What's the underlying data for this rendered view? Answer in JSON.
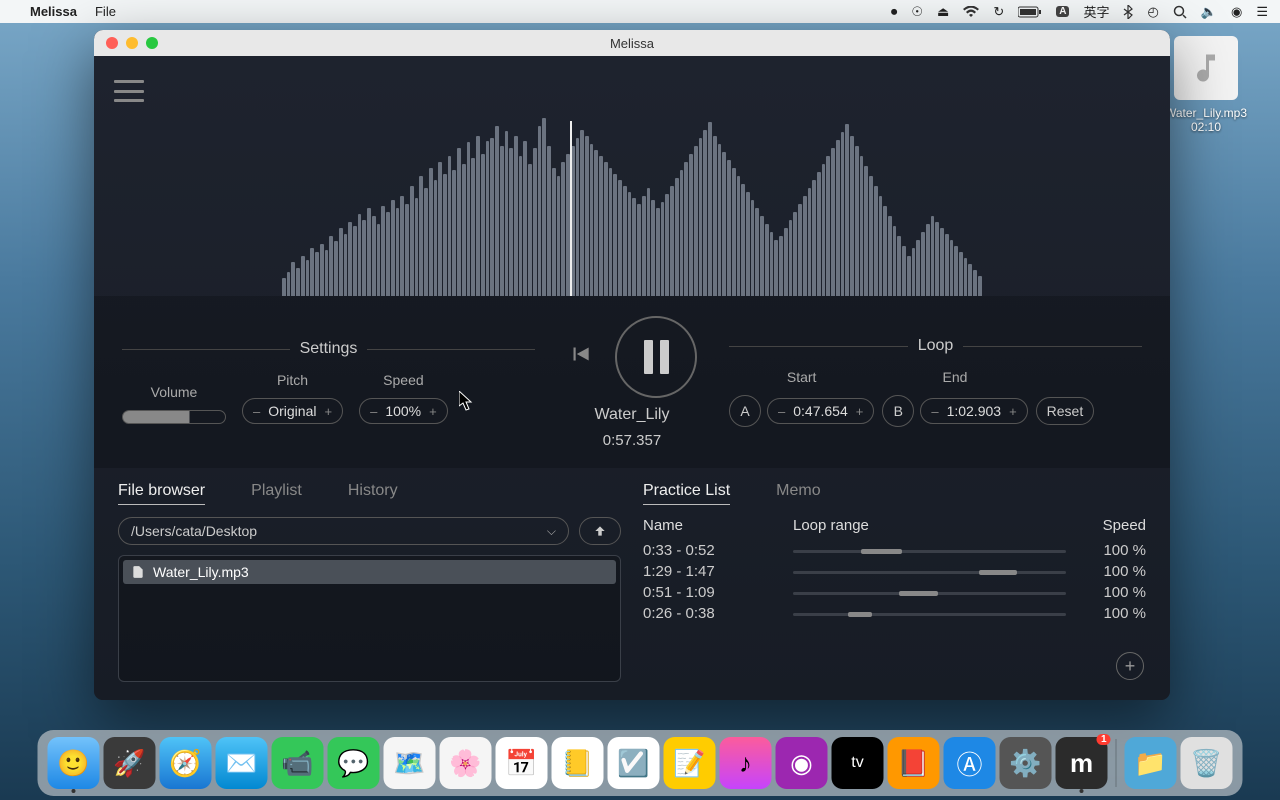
{
  "menubar": {
    "app_name": "Melissa",
    "menus": [
      "File"
    ],
    "status_ime_badge": "A",
    "status_ime_label": "英字"
  },
  "desktop_file": {
    "name": "Water_Lily.mp3",
    "duration": "02:10"
  },
  "window": {
    "title": "Melissa"
  },
  "settings": {
    "panel_label": "Settings",
    "volume_label": "Volume",
    "pitch_label": "Pitch",
    "pitch_value": "Original",
    "speed_label": "Speed",
    "speed_value": "100%"
  },
  "player": {
    "track_name": "Water_Lily",
    "time": "0:57.357"
  },
  "loop": {
    "panel_label": "Loop",
    "start_label": "Start",
    "end_label": "End",
    "a_label": "A",
    "b_label": "B",
    "start_value": "0:47.654",
    "end_value": "1:02.903",
    "reset_label": "Reset"
  },
  "left_tabs": {
    "file_browser": "File browser",
    "playlist": "Playlist",
    "history": "History"
  },
  "file_browser": {
    "path": "/Users/cata/Desktop",
    "files": [
      "Water_Lily.mp3"
    ]
  },
  "right_tabs": {
    "practice_list": "Practice List",
    "memo": "Memo"
  },
  "practice": {
    "col_name": "Name",
    "col_range": "Loop range",
    "col_speed": "Speed",
    "rows": [
      {
        "name": "0:33 - 0:52",
        "range_left": 25,
        "range_width": 15,
        "speed": "100 %"
      },
      {
        "name": "1:29 - 1:47",
        "range_left": 68,
        "range_width": 14,
        "speed": "100 %"
      },
      {
        "name": "0:51 - 1:09",
        "range_left": 39,
        "range_width": 14,
        "speed": "100 %"
      },
      {
        "name": "0:26 - 0:38",
        "range_left": 20,
        "range_width": 9,
        "speed": "100 %"
      }
    ]
  },
  "dock": {
    "badge_count": "1"
  },
  "waveform_heights": [
    18,
    24,
    34,
    28,
    40,
    36,
    48,
    44,
    52,
    46,
    60,
    55,
    68,
    62,
    74,
    70,
    82,
    76,
    88,
    80,
    72,
    90,
    84,
    96,
    88,
    100,
    92,
    110,
    98,
    120,
    108,
    128,
    116,
    134,
    122,
    140,
    126,
    148,
    132,
    154,
    138,
    160,
    142,
    155,
    158,
    170,
    150,
    165,
    148,
    160,
    140,
    155,
    132,
    148,
    170,
    178,
    150,
    128,
    120,
    134,
    142,
    150,
    158,
    166,
    160,
    152,
    146,
    140,
    134,
    128,
    122,
    116,
    110,
    104,
    98,
    92,
    100,
    108,
    96,
    88,
    94,
    102,
    110,
    118,
    126,
    134,
    142,
    150,
    158,
    166,
    174,
    160,
    152,
    144,
    136,
    128,
    120,
    112,
    104,
    96,
    88,
    80,
    72,
    64,
    56,
    60,
    68,
    76,
    84,
    92,
    100,
    108,
    116,
    124,
    132,
    140,
    148,
    156,
    164,
    172,
    160,
    150,
    140,
    130,
    120,
    110,
    100,
    90,
    80,
    70,
    60,
    50,
    40,
    48,
    56,
    64,
    72,
    80,
    74,
    68,
    62,
    56,
    50,
    44,
    38,
    32,
    26,
    20
  ]
}
